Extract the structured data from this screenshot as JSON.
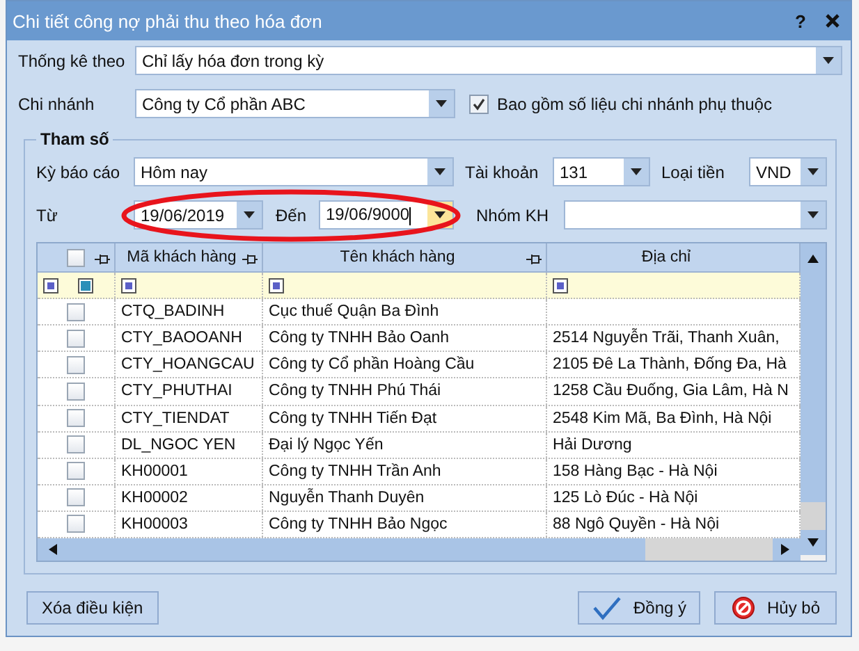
{
  "window": {
    "title": "Chi tiết công nợ phải thu theo hóa đơn",
    "help": "?"
  },
  "thong_ke_theo": {
    "label": "Thống kê theo",
    "value": "Chỉ lấy hóa đơn trong kỳ"
  },
  "chi_nhanh": {
    "label": "Chi nhánh",
    "value": "Công ty Cổ phần ABC"
  },
  "include_dependent": {
    "label": "Bao gồm số liệu chi nhánh phụ thuộc",
    "checked": true
  },
  "parameters": {
    "title": "Tham số",
    "ky_bao_cao": {
      "label": "Kỳ báo cáo",
      "value": "Hôm nay"
    },
    "tai_khoan": {
      "label": "Tài khoản",
      "value": "131"
    },
    "loai_tien": {
      "label": "Loại tiền",
      "value": "VND"
    },
    "tu": {
      "label": "Từ",
      "value": "19/06/2019",
      "focused": false
    },
    "den": {
      "label": "Đến",
      "value": "19/06/9000",
      "focused": true
    },
    "nhom_kh": {
      "label": "Nhóm KH"
    },
    "annotations": [
      {
        "kind": "ellipse"
      }
    ]
  },
  "table": {
    "select_all_checked": false,
    "columns": [
      {
        "label": "Mã khách hàng",
        "pinned": true
      },
      {
        "label": "Tên khách hàng",
        "pinned": true
      },
      {
        "label": "Địa chỉ",
        "pinned": false
      }
    ],
    "rows": [
      {
        "checked": false,
        "code": "CTQ_BADINH",
        "name": "Cục thuế Quận Ba Đình"
      },
      {
        "checked": false,
        "code": "CTY_BAOOANH",
        "name": "Công ty TNHH Bảo Oanh",
        "address": "2514 Nguyễn Trãi, Thanh Xuân,"
      },
      {
        "checked": false,
        "code": "CTY_HOANGCAU",
        "name": "Công ty Cổ phần Hoàng Cầu",
        "address": "2105 Đê La Thành, Đống Đa, Hà"
      },
      {
        "checked": false,
        "code": "CTY_PHUTHAI",
        "name": "Công ty TNHH Phú Thái",
        "address": "1258 Cầu Đuống, Gia Lâm, Hà N"
      },
      {
        "checked": false,
        "code": "CTY_TIENDAT",
        "name": "Công ty TNHH Tiến Đạt",
        "address": "2548 Kim Mã, Ba Đình, Hà Nội"
      },
      {
        "checked": false,
        "code": "DL_NGOC YEN",
        "name": "Đại lý Ngọc Yến",
        "address": "Hải Dương"
      },
      {
        "checked": false,
        "code": "KH00001",
        "name": "Công ty TNHH Trần Anh",
        "address": "158 Hàng Bạc - Hà Nội"
      },
      {
        "checked": false,
        "code": "KH00002",
        "name": "Nguyễn Thanh Duyên",
        "address": "125 Lò Đúc - Hà Nội"
      },
      {
        "checked": false,
        "code": "KH00003",
        "name": "Công ty TNHH Bảo Ngọc",
        "address": "88 Ngô Quyền - Hà Nội"
      }
    ]
  },
  "buttons": [
    {
      "kind": "plain",
      "label": "Xóa điều kiện"
    },
    {
      "kind": "ok",
      "label": "Đồng ý"
    },
    {
      "kind": "cancel",
      "label": "Hủy bỏ"
    }
  ]
}
